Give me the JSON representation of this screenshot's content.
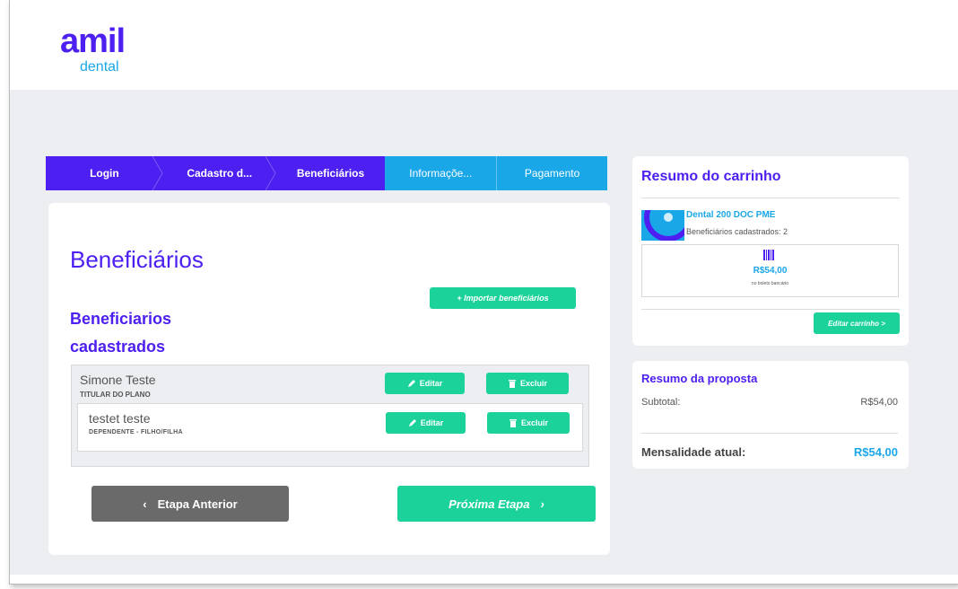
{
  "brand": {
    "logo_top": "amil",
    "logo_bottom": "dental",
    "primary_color": "#4d1ff0",
    "accent_color": "#1aa7e8",
    "action_color": "#1bd39a"
  },
  "stepper": {
    "steps": [
      {
        "label": "Login",
        "state": "done"
      },
      {
        "label": "Cadastro d...",
        "state": "done"
      },
      {
        "label": "Beneficiários",
        "state": "current"
      },
      {
        "label": "Informaçõe...",
        "state": "todo"
      },
      {
        "label": "Pagamento",
        "state": "todo"
      }
    ]
  },
  "main": {
    "page_title": "Beneficiários",
    "section_title": "Beneficiarios cadastrados",
    "import_button": "+ Importar beneficiários",
    "holder": {
      "name": "Simone Teste",
      "role": "TITULAR DO PLANO",
      "edit_label": "Editar",
      "delete_label": "Excluir"
    },
    "dependent": {
      "name": "testet teste",
      "role": "DEPENDENTE  -  FILHO/FILHA",
      "edit_label": "Editar",
      "delete_label": "Excluir"
    },
    "prev_button": "Etapa Anterior",
    "next_button": "Próxima Etapa",
    "prev_icon": "chevron-left-icon",
    "next_icon": "chevron-right-icon"
  },
  "cart": {
    "title": "Resumo do carrinho",
    "product_name": "Dental 200 DOC PME",
    "product_count": "Beneficiários cadastrados: 2",
    "price": "R$54,00",
    "payment_note": "no boleto bancário",
    "edit_button": "Editar carrinho >"
  },
  "proposal": {
    "title": "Resumo da proposta",
    "subtotal_label": "Subtotal:",
    "subtotal_value": "R$54,00",
    "total_label": "Mensalidade atual:",
    "total_value": "R$54,00"
  }
}
